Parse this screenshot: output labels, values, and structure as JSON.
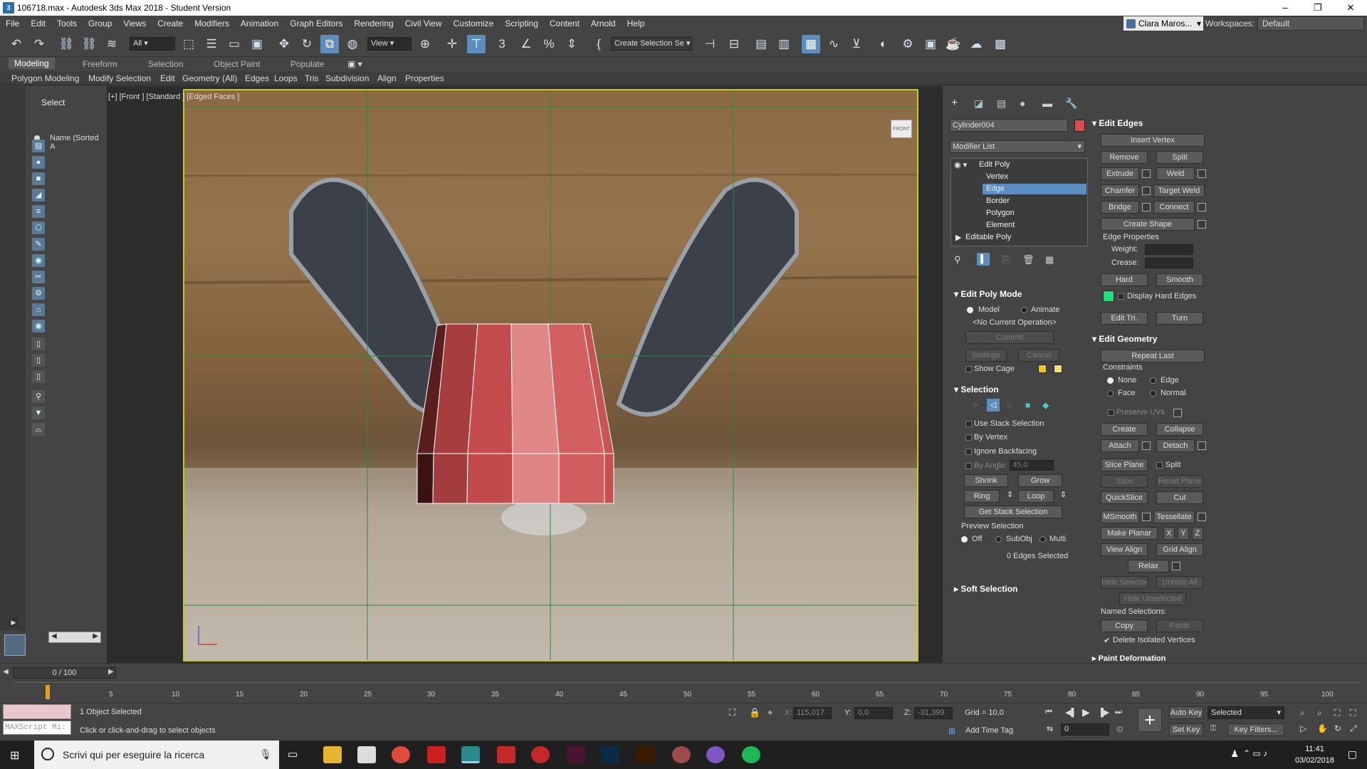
{
  "title": "106718.max - Autodesk 3ds Max 2018 - Student Version",
  "window_controls": {
    "minimize": "–",
    "maximize": "❐",
    "close": "✕"
  },
  "menu": [
    "File",
    "Edit",
    "Tools",
    "Group",
    "Views",
    "Create",
    "Modifiers",
    "Animation",
    "Graph Editors",
    "Rendering",
    "Civil View",
    "Customize",
    "Scripting",
    "Content",
    "Arnold",
    "Help"
  ],
  "user": "Clara Maros...",
  "workspaces_label": "Workspaces:",
  "workspace": "Default",
  "toolbar": {
    "filter": "All",
    "view": "View",
    "selection_set": "Create Selection Se"
  },
  "ribbon_tabs": [
    "Modeling",
    "Freeform",
    "Selection",
    "Object Paint",
    "Populate"
  ],
  "ribbon_items": [
    "Polygon Modeling",
    "Modify Selection",
    "Edit",
    "Geometry (All)",
    "Edges",
    "Loops",
    "Tris",
    "Subdivision",
    "Align",
    "Properties"
  ],
  "scene_explorer": {
    "select": "Select",
    "name_col": "Name (Sorted A"
  },
  "viewport": {
    "label": "[+] [Front ] [Standard ] [Edged Faces ]",
    "viewcube": "FRONT"
  },
  "panel": {
    "object_name": "Cylinder004",
    "object_color": "#d94f4f",
    "modifier_list": "Modifier List",
    "stack": [
      "Edit Poly",
      "Vertex",
      "Edge",
      "Border",
      "Polygon",
      "Element",
      "Editable Poly"
    ],
    "edit_poly_mode": {
      "title": "Edit Poly Mode",
      "model": "Model",
      "animate": "Animate",
      "current_op": "<No Current Operation>",
      "commit": "Commit",
      "settings": "Settings",
      "cancel": "Cancel",
      "show_cage": "Show Cage"
    },
    "selection": {
      "title": "Selection",
      "use_stack": "Use Stack Selection",
      "by_vertex": "By Vertex",
      "ignore_backfacing": "Ignore Backfacing",
      "by_angle": "By Angle:",
      "angle_value": "45,0",
      "shrink": "Shrink",
      "grow": "Grow",
      "ring": "Ring",
      "loop": "Loop",
      "get_stack": "Get Stack Selection",
      "preview": "Preview Selection",
      "off": "Off",
      "subobj": "SubObj",
      "multi": "Multi",
      "count": "0 Edges Selected"
    },
    "soft_selection": "Soft Selection",
    "edit_edges": {
      "title": "Edit Edges",
      "insert_vertex": "Insert Vertex",
      "remove": "Remove",
      "split": "Split",
      "extrude": "Extrude",
      "weld": "Weld",
      "chamfer": "Chamfer",
      "target_weld": "Target Weld",
      "bridge": "Bridge",
      "connect": "Connect",
      "create_shape": "Create Shape",
      "edge_props": "Edge Properties",
      "weight": "Weight:",
      "crease": "Crease:",
      "hard": "Hard",
      "smooth": "Smooth",
      "display_hard": "Display Hard Edges",
      "edit_tri": "Edit Tri.",
      "turn": "Turn"
    },
    "edit_geometry": {
      "title": "Edit Geometry",
      "repeat_last": "Repeat Last",
      "constraints": "Constraints",
      "none": "None",
      "edge": "Edge",
      "face": "Face",
      "normal": "Normal",
      "preserve_uvs": "Preserve UVs",
      "create": "Create",
      "collapse": "Collapse",
      "attach": "Attach",
      "detach": "Detach",
      "slice_plane": "Slice Plane",
      "split": "Split",
      "slice": "Slice",
      "reset_plane": "Reset Plane",
      "quickslice": "QuickSlice",
      "cut": "Cut",
      "msmooth": "MSmooth",
      "tessellate": "Tessellate",
      "make_planar": "Make Planar",
      "x": "X",
      "y": "Y",
      "z": "Z",
      "view_align": "View Align",
      "grid_align": "Grid Align",
      "relax": "Relax",
      "hide_selected": "Hide Selected",
      "unhide_all": "Unhide All",
      "hide_unselected": "Hide Unselected",
      "named_sel": "Named Selections:",
      "copy": "Copy",
      "paste": "Paste",
      "delete_isolated": "Delete Isolated Vertices"
    },
    "paint_deformation": "Paint Deformation"
  },
  "timeline": {
    "frame": "0 / 100",
    "ticks": [
      "5",
      "10",
      "15",
      "20",
      "25",
      "30",
      "35",
      "40",
      "45",
      "50",
      "55",
      "60",
      "65",
      "70",
      "75",
      "80",
      "85",
      "90",
      "95",
      "100"
    ]
  },
  "status": {
    "selected": "1 Object Selected",
    "prompt": "Click or click-and-drag to select objects",
    "maxscript": "MAXScript Mi:",
    "x_label": "X:",
    "x": "115,017",
    "y_label": "Y:",
    "y": "0,0",
    "z_label": "Z:",
    "z": "-31,399",
    "grid": "Grid = 10,0",
    "add_time_tag": "Add Time Tag",
    "auto_key": "Auto Key",
    "set_key": "Set Key",
    "key_mode": "Selected",
    "key_filters": "Key Filters...",
    "frame_field": "0"
  },
  "taskbar": {
    "search": "Scrivi qui per eseguire la ricerca",
    "time": "11:41",
    "date": "03/02/2018"
  }
}
